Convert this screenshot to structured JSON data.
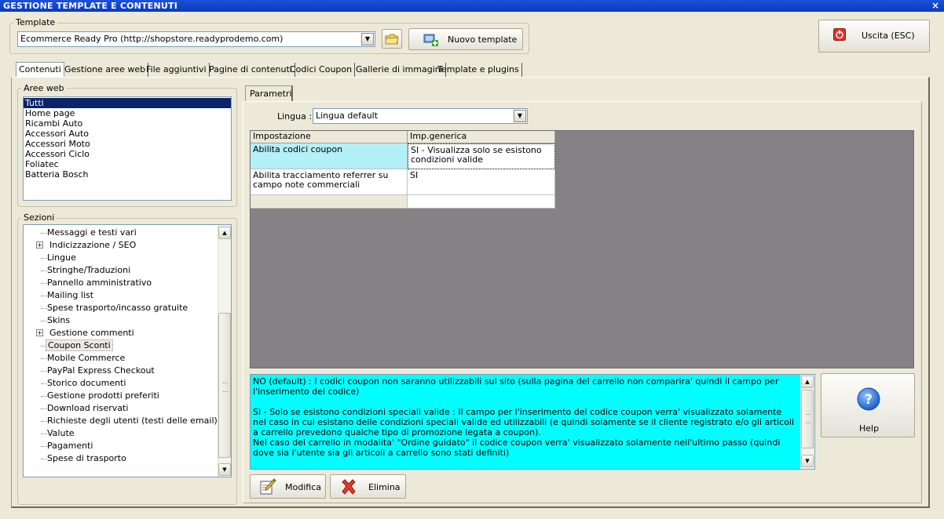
{
  "window": {
    "title": "GESTIONE TEMPLATE E CONTENUTI",
    "close": "×"
  },
  "template": {
    "group_label": "Template",
    "selected": "Ecommerce Ready Pro (http://shopstore.readyprodemo.com)",
    "new_label": "Nuovo template"
  },
  "exit": {
    "label": "Uscita (ESC)"
  },
  "tabs": [
    {
      "label": "Contenuti"
    },
    {
      "label": "Gestione aree web"
    },
    {
      "label": "File aggiuntivi"
    },
    {
      "label": "Pagine di contenuti"
    },
    {
      "label": "Codici Coupon"
    },
    {
      "label": "Gallerie di immagini"
    },
    {
      "label": "Template e plugins"
    }
  ],
  "aree_web": {
    "label": "Aree web",
    "items": [
      "Tutti",
      "Home page",
      "Ricambi Auto",
      "Accessori Auto",
      "Accessori Moto",
      "Accessori Ciclo",
      "Foliatec",
      "Batteria Bosch"
    ]
  },
  "sezioni": {
    "label": "Sezioni",
    "items": [
      {
        "label": "Messaggi e testi vari",
        "expand": false
      },
      {
        "label": "Indicizzazione / SEO",
        "expand": true
      },
      {
        "label": "Lingue",
        "expand": false
      },
      {
        "label": "Stringhe/Traduzioni",
        "expand": false
      },
      {
        "label": "Pannello amministrativo",
        "expand": false
      },
      {
        "label": "Mailing list",
        "expand": false
      },
      {
        "label": "Spese trasporto/incasso gratuite",
        "expand": false
      },
      {
        "label": "Skins",
        "expand": false
      },
      {
        "label": "Gestione commenti",
        "expand": true
      },
      {
        "label": "Coupon Sconti",
        "expand": false
      },
      {
        "label": "Mobile Commerce",
        "expand": false
      },
      {
        "label": "PayPal Express Checkout",
        "expand": false
      },
      {
        "label": "Storico documenti",
        "expand": false
      },
      {
        "label": "Gestione prodotti preferiti",
        "expand": false
      },
      {
        "label": "Download riservati",
        "expand": false
      },
      {
        "label": "Richieste degli utenti (testi delle email)",
        "expand": false
      },
      {
        "label": "Valute",
        "expand": false
      },
      {
        "label": "Pagamenti",
        "expand": false
      },
      {
        "label": "Spese di trasporto",
        "expand": false
      }
    ]
  },
  "parametri": {
    "tab": "Parametri",
    "lingua_label": "Lingua :",
    "lingua_value": "Lingua default",
    "grid": {
      "col1": "Impostazione",
      "col2": "Imp.generica",
      "row1_name": "Abilita codici coupon",
      "row1_value": "SI - Visualizza solo se esistono condizioni valide",
      "row2_name": "Abilita tracciamento referrer su campo note commerciali",
      "row2_value": "SI"
    },
    "description": "NO (default) : I codici coupon non saranno utilizzabili sul sito (sulla pagina del carrello non comparira' quindi il campo per l'inserimento del codice)\n\nSI - Solo se esistono condizioni speciali valide : Il campo per l'inserimento del codice coupon verra' visualizzato solamente nel caso in cui esistano delle condizioni speciali valide ed utilizzabili (e quindi solamente se il cliente registrato e/o gli articoli a carrello prevedono qualche tipo di promozione legata a coupon).\nNel caso del carrello in modalita' \"Ordine guidato\" il codice coupon verra' visualizzato solamente nell'ultimo passo (quindi dove sia l'utente sia gli articoli a carrello sono stati definiti)\n\nSI - Visualizza sempre : Il campo per l'inserimento del codice coupon verra' sempre visualizzato.",
    "help_label": "Help",
    "modifica_label": "Modifica",
    "elimina_label": "Elimina"
  }
}
